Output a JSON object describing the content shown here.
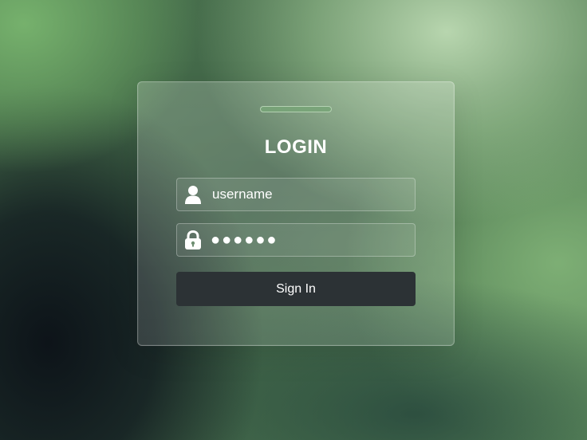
{
  "login_card": {
    "title": "LOGIN",
    "username": {
      "icon": "user-icon",
      "value": "username"
    },
    "password": {
      "icon": "lock-icon",
      "masked_value": "●●●●●●"
    },
    "sign_in_label": "Sign In"
  },
  "colors": {
    "button_bg": "#2c3235",
    "text": "#ffffff",
    "handle": "#78a578"
  }
}
